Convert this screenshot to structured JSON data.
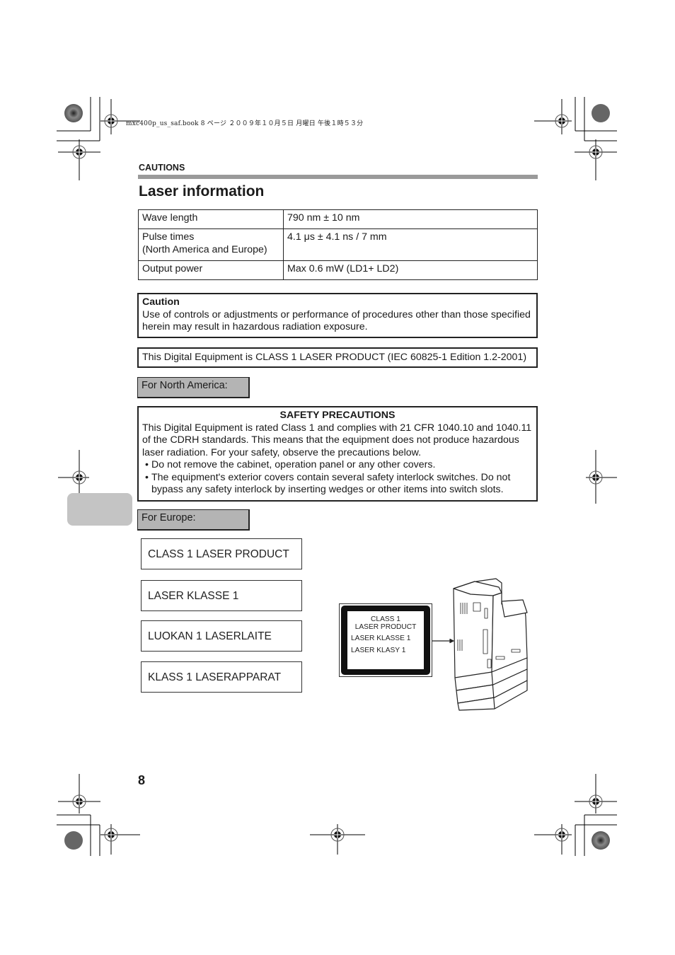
{
  "print_slug": "mxc400p_us_saf.book  8 ページ  ２００９年１０月５日  月曜日  午後１時５３分",
  "header": {
    "section_label": "CAUTIONS",
    "page_title": "Laser information"
  },
  "spec_table": {
    "rows": [
      {
        "label": "Wave length",
        "label_line2": "",
        "value": "790 nm ± 10 nm"
      },
      {
        "label": "Pulse times",
        "label_line2": "(North America and Europe)",
        "value": "4.1 μs ± 4.1 ns / 7 mm"
      },
      {
        "label": "Output power",
        "label_line2": "",
        "value": "Max 0.6 mW (LD1+ LD2)"
      }
    ]
  },
  "caution_box": {
    "title": "Caution",
    "text": "Use of controls or adjustments or performance of procedures other than those specified herein may result in hazardous radiation exposure."
  },
  "class_statement": "This Digital Equipment is CLASS 1 LASER PRODUCT (IEC 60825-1 Edition 1.2-2001)",
  "north_america": {
    "heading": "For North America:",
    "safety_title": "SAFETY PRECAUTIONS",
    "safety_text": "This Digital Equipment is rated Class 1 and complies with 21 CFR 1040.10 and 1040.11 of the CDRH standards. This means that the equipment does not produce hazardous laser radiation. For your safety, observe the precautions below.",
    "bullets": [
      "Do not remove the cabinet, operation panel or any other covers.",
      "The equipment's exterior covers contain several safety interlock switches. Do not bypass any safety interlock by inserting wedges or other items into switch slots."
    ]
  },
  "europe": {
    "heading": "For Europe:",
    "labels": [
      "CLASS 1 LASER PRODUCT",
      "LASER KLASSE 1",
      "LUOKAN 1 LASERLAITE",
      "KLASS 1 LASERAPPARAT"
    ]
  },
  "laser_sign": {
    "line1": "CLASS 1",
    "line2": "LASER PRODUCT",
    "line3": "LASER KLASSE 1",
    "line4": "LASER KLASY 1"
  },
  "illustration": {
    "name": "printer-with-laser-label"
  },
  "footer": {
    "page_number": "8"
  },
  "colors": {
    "section_rule": "#9a9a9a",
    "region_heading_bg": "#b4b4b4",
    "side_tab": "#c4c4c4"
  }
}
